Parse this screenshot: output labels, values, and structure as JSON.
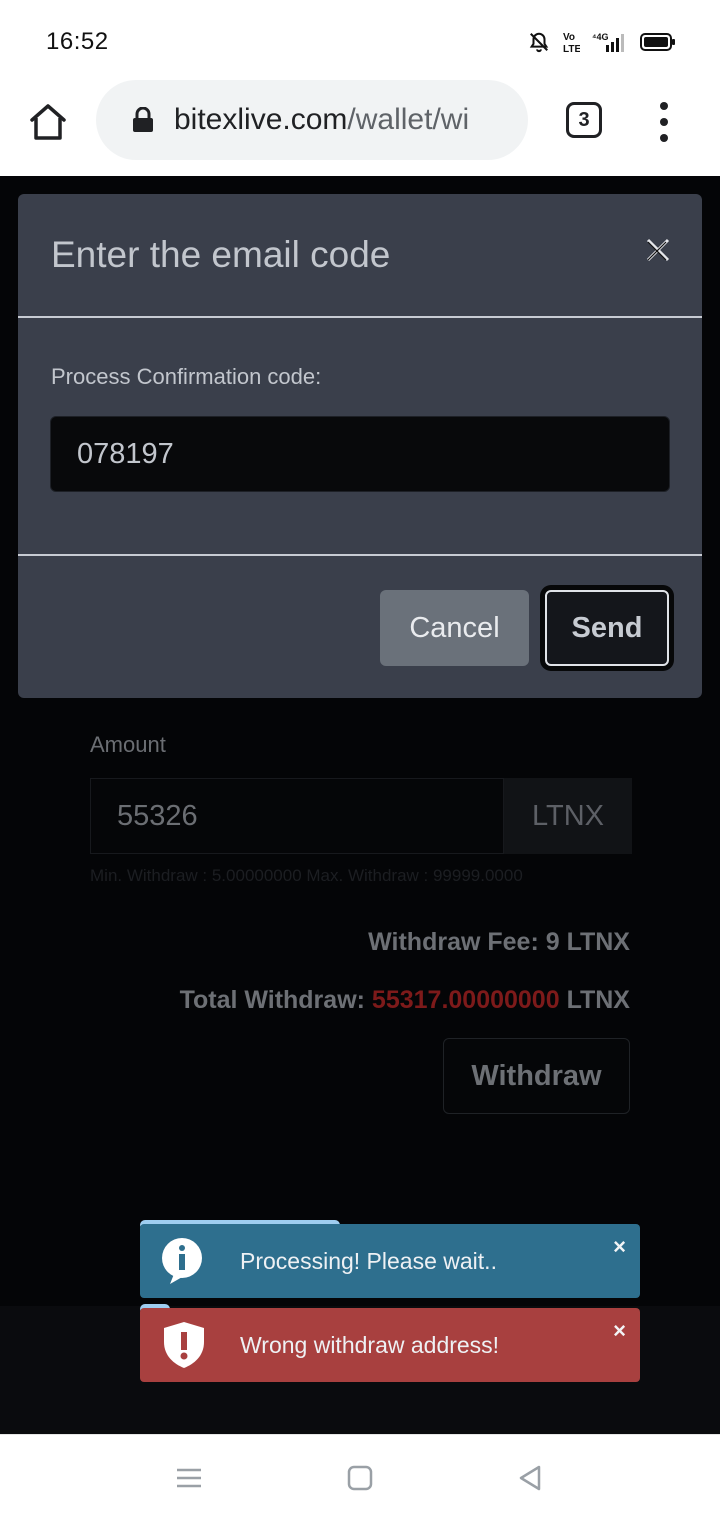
{
  "status": {
    "time": "16:52",
    "network": "4G",
    "volte": "Vo LTE"
  },
  "browser": {
    "url_domain": "bitexlive.com",
    "url_path": "/wallet/wi",
    "tab_count": "3"
  },
  "modal": {
    "title": "Enter the email code",
    "code_label": "Process Confirmation code:",
    "code_value": "078197",
    "cancel_label": "Cancel",
    "send_label": "Send"
  },
  "withdraw": {
    "amount_label": "Amount",
    "amount_value": "55326",
    "amount_unit": "LTNX",
    "minmax": "Min. Withdraw : 5.00000000 Max. Withdraw : 99999.0000",
    "fee_text": "Withdraw Fee: 9 LTNX",
    "total_label": "Total Withdraw: ",
    "total_value": "55317.00000000",
    "total_unit": " LTNX",
    "button_label": "Withdraw"
  },
  "toasts": [
    {
      "type": "info",
      "message": "Processing! Please wait..",
      "close": "×",
      "progress": 0.4
    },
    {
      "type": "error",
      "message": "Wrong withdraw address!",
      "close": "×",
      "progress": 0.06
    }
  ],
  "colors": {
    "info": "#2e6f8e",
    "error": "#a8403f",
    "modal": "#3a3f4b",
    "total_value": "#7d1a1a"
  }
}
